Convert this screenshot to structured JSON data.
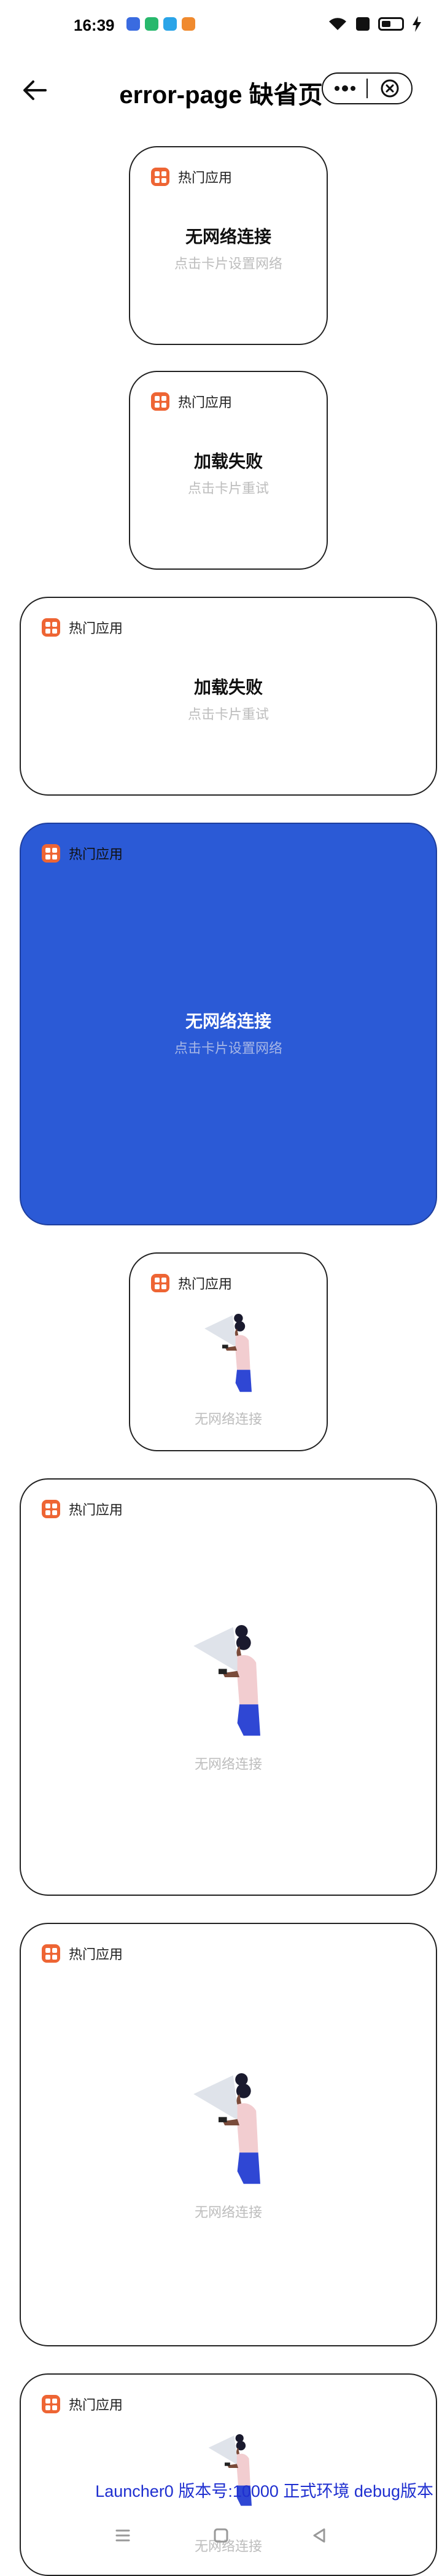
{
  "status_bar": {
    "time": "16:39",
    "app_colors": [
      "#3a6be0",
      "#27b86c",
      "#2aa4e8",
      "#f08a2e"
    ]
  },
  "nav": {
    "title": "error-page 缺省页",
    "back_icon": "arrow-left-icon",
    "more_icon": "more-icon",
    "close_icon": "close-circle-icon"
  },
  "cards": [
    {
      "app_name": "热门应用",
      "title": "无网络连接",
      "subtitle": "点击卡片设置网络"
    },
    {
      "app_name": "热门应用",
      "title": "加载失败",
      "subtitle": "点击卡片重试"
    },
    {
      "app_name": "热门应用",
      "title": "加载失败",
      "subtitle": "点击卡片重试"
    },
    {
      "app_name": "热门应用",
      "title": "无网络连接",
      "subtitle": "点击卡片设置网络"
    },
    {
      "app_name": "热门应用",
      "subtitle": "无网络连接"
    },
    {
      "app_name": "热门应用",
      "subtitle": "无网络连接"
    },
    {
      "app_name": "热门应用",
      "subtitle": "无网络连接"
    },
    {
      "app_name": "热门应用",
      "subtitle": "无网络连接"
    }
  ],
  "debug_text": "Launcher0 版本号:10000 正式环境 debug版本",
  "home_bar": {
    "menu_icon": "menu-icon",
    "home_icon": "home-square-icon",
    "back_icon": "back-triangle-icon"
  },
  "colors": {
    "accent_blue": "#2b5ad6",
    "app_icon": "#ee6534",
    "debug_text": "#1f2fd0"
  }
}
